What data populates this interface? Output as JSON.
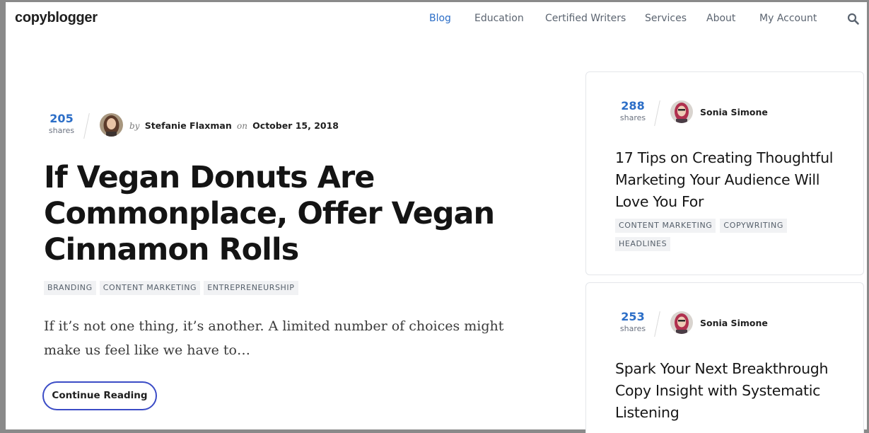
{
  "header": {
    "logo": "copyblogger",
    "nav": [
      {
        "label": "Blog",
        "active": true
      },
      {
        "label": "Education"
      },
      {
        "label": "Certified Writers"
      },
      {
        "label": "Services"
      },
      {
        "label": "About"
      },
      {
        "label": "My Account"
      }
    ],
    "search_icon": "search-icon"
  },
  "article": {
    "shares_count": "205",
    "shares_label": "shares",
    "by": "by",
    "author": "Stefanie Flaxman",
    "on": "on",
    "date": "October 15, 2018",
    "title": "If Vegan Donuts Are Commonplace, Offer Vegan Cinnamon Rolls",
    "tags": [
      "BRANDING",
      "CONTENT MARKETING",
      "ENTREPRENEURSHIP"
    ],
    "excerpt": "If it’s not one thing, it’s another. A limited number of choices might make us feel like we have to…",
    "cta": "Continue Reading"
  },
  "sidebar": {
    "cards": [
      {
        "shares_count": "288",
        "shares_label": "shares",
        "author": "Sonia Simone",
        "title": "17 Tips on Creating Thoughtful Marketing Your Audience Will Love You For",
        "tags": [
          "CONTENT MARKETING",
          "COPYWRITING",
          "HEADLINES"
        ]
      },
      {
        "shares_count": "253",
        "shares_label": "shares",
        "author": "Sonia Simone",
        "title": "Spark Your Next Breakthrough Copy Insight with Systematic Listening",
        "tags": []
      }
    ]
  },
  "colors": {
    "accent": "#2c6ec7",
    "button_border": "#3b4cc6",
    "tag_bg": "#f1f2f4"
  }
}
